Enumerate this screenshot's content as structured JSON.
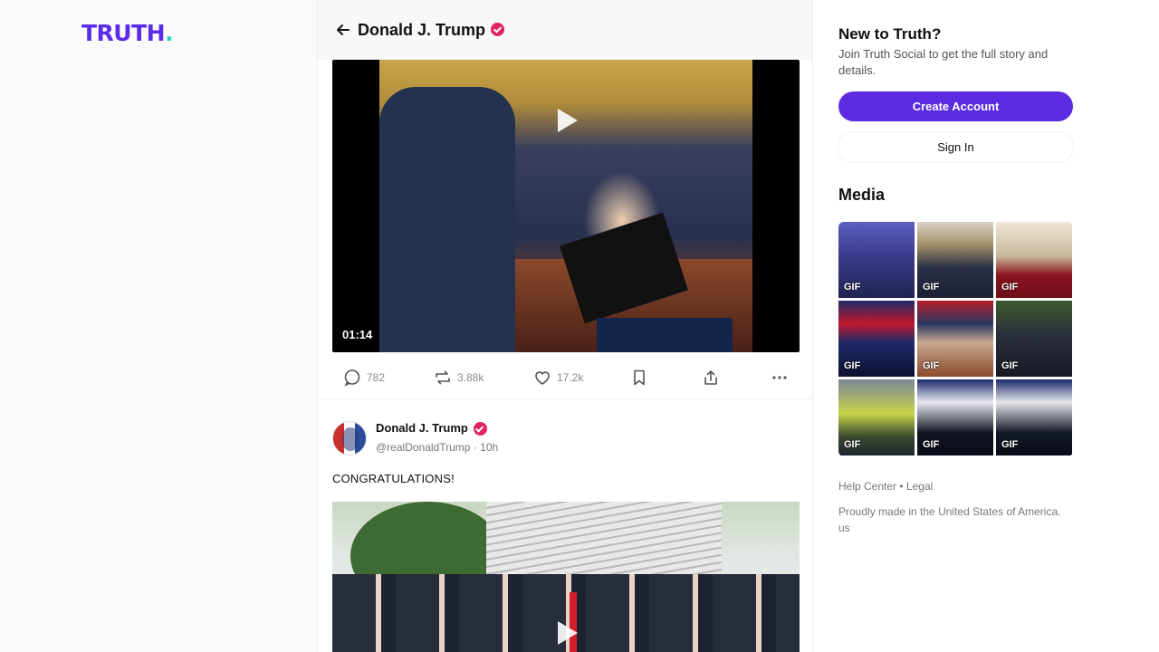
{
  "brand": {
    "logo_text": "TRUTH",
    "logo_dot": ".",
    "primary_color": "#5a2be0",
    "accent_color": "#27d3c3",
    "verified_color": "#e0245e"
  },
  "header": {
    "back_icon": "back-arrow-icon",
    "title": "Donald J. Trump"
  },
  "post1": {
    "video": {
      "duration": "01:14",
      "play_icon": "play-icon"
    },
    "actions": {
      "replies": "782",
      "retruths": "3.88k",
      "likes": "17.2k",
      "icons": [
        "comment-icon",
        "retruth-icon",
        "heart-icon",
        "bookmark-icon",
        "share-icon",
        "more-icon"
      ]
    }
  },
  "post2": {
    "author": "Donald J. Trump",
    "handle": "@realDonaldTrump",
    "separator": "·",
    "time": "10h",
    "text": "CONGRATULATIONS!"
  },
  "sidebar": {
    "title": "New to Truth?",
    "subtitle": "Join Truth Social to get the full story and details.",
    "create_account": "Create Account",
    "sign_in": "Sign In",
    "media_title": "Media",
    "media": [
      {
        "label": "GIF"
      },
      {
        "label": "GIF"
      },
      {
        "label": "GIF"
      },
      {
        "label": "GIF"
      },
      {
        "label": "GIF"
      },
      {
        "label": "GIF"
      },
      {
        "label": "GIF"
      },
      {
        "label": "GIF"
      },
      {
        "label": "GIF"
      }
    ],
    "footer": {
      "help": "Help Center",
      "bullet": "•",
      "legal": "Legal",
      "made_in": "Proudly made in the United States of America. us"
    }
  }
}
